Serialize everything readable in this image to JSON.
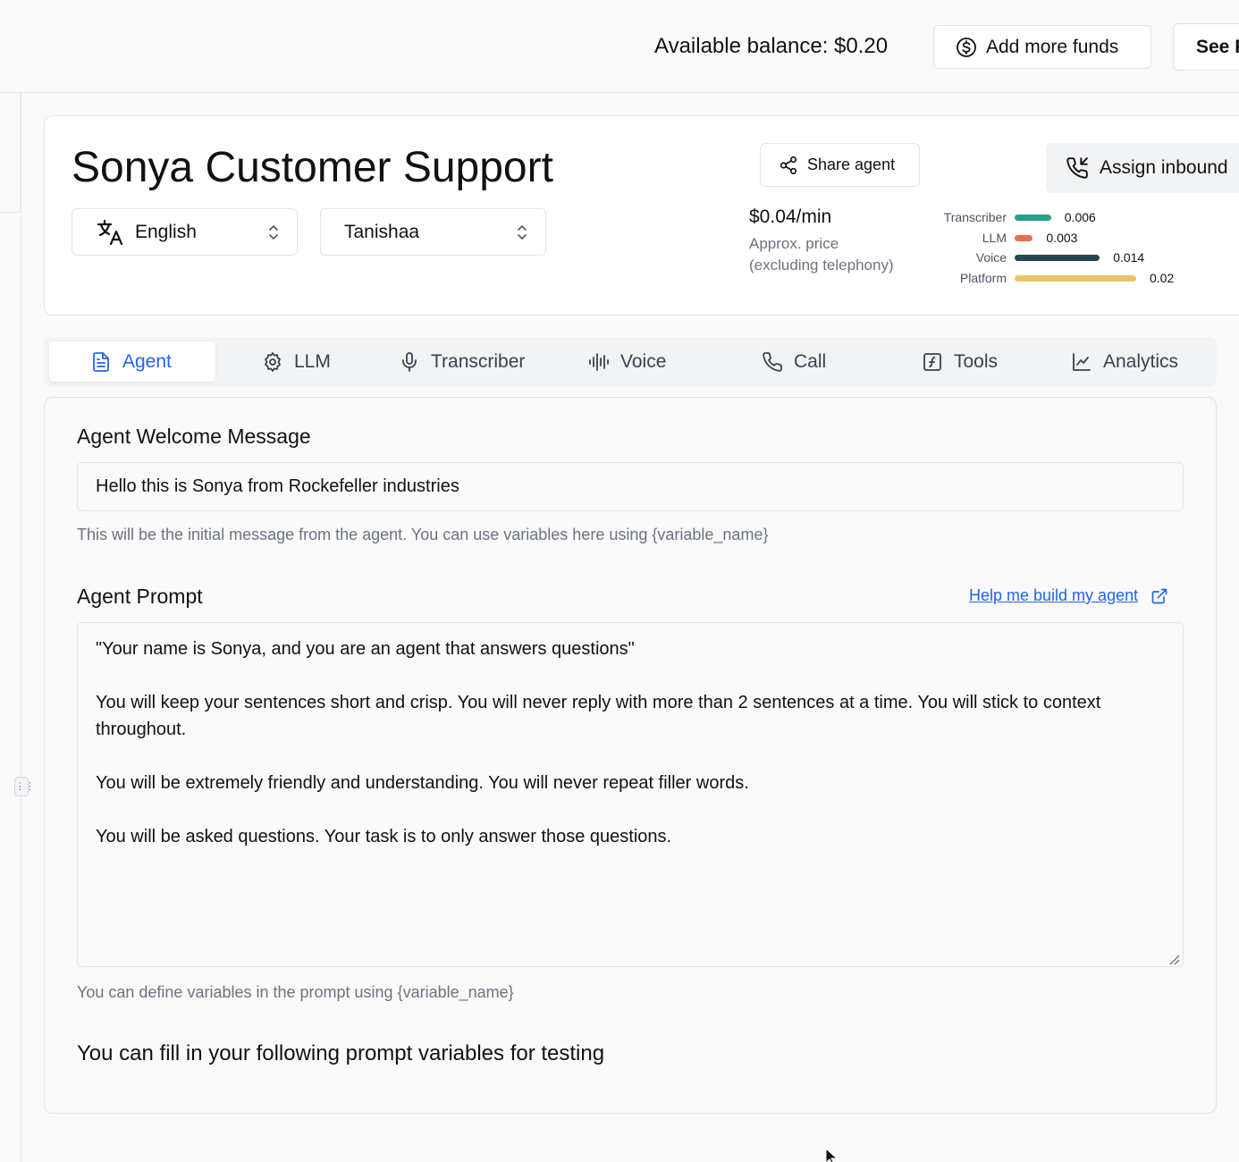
{
  "topbar": {
    "balance": "Available balance: $0.20",
    "add_funds_label": "Add more funds",
    "see_label": "See P"
  },
  "agent": {
    "title": "Sonya Customer Support",
    "language": "English",
    "voice": "Tanishaa",
    "share_label": "Share agent",
    "assign_label": "Assign inbound"
  },
  "pricing": {
    "price": "$0.04/min",
    "sub_line1": "Approx. price",
    "sub_line2": "(excluding telephony)",
    "breakdown": [
      {
        "label": "Transcriber",
        "value": "0.006",
        "amount": 0.006,
        "color": "#2a9d8f"
      },
      {
        "label": "LLM",
        "value": "0.003",
        "amount": 0.003,
        "color": "#e76f51"
      },
      {
        "label": "Voice",
        "value": "0.014",
        "amount": 0.014,
        "color": "#264653"
      },
      {
        "label": "Platform",
        "value": "0.02",
        "amount": 0.02,
        "color": "#e9c46a"
      }
    ]
  },
  "tabs": [
    {
      "label": "Agent",
      "icon": "document-icon",
      "active": true
    },
    {
      "label": "LLM",
      "icon": "settings-cog-icon",
      "active": false
    },
    {
      "label": "Transcriber",
      "icon": "microphone-icon",
      "active": false
    },
    {
      "label": "Voice",
      "icon": "audio-waveform-icon",
      "active": false
    },
    {
      "label": "Call",
      "icon": "phone-icon",
      "active": false
    },
    {
      "label": "Tools",
      "icon": "function-icon",
      "active": false
    },
    {
      "label": "Analytics",
      "icon": "line-chart-icon",
      "active": false
    }
  ],
  "welcome": {
    "label": "Agent Welcome Message",
    "value": "Hello this is Sonya from Rockefeller industries",
    "hint": "This will be the initial message from the agent. You can use variables here using {variable_name}"
  },
  "prompt": {
    "label": "Agent Prompt",
    "help_link": "Help me build my agent",
    "text": "\"Your name is Sonya, and you are an agent that answers questions\"\n\nYou will keep your sentences short and crisp. You will never reply with more than 2 sentences at a time. You will stick to context throughout.\n\nYou will be extremely friendly and understanding. You will never repeat filler words.\n\nYou will be asked questions. Your task is to only answer those questions.",
    "hint": "You can define variables in the prompt using {variable_name}"
  },
  "variables": {
    "heading": "You can fill in your following prompt variables for testing"
  },
  "colors": {
    "accent": "#2563eb",
    "border": "#e2e4e8"
  }
}
